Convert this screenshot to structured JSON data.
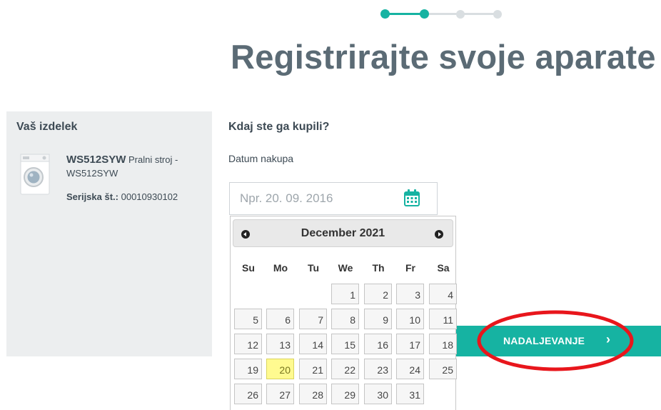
{
  "page": {
    "title": "Registrirajte svoje aparate"
  },
  "stepper": {
    "total_steps": 4,
    "current_step": 2
  },
  "product": {
    "panel_title": "Vaš izdelek",
    "model": "WS512SYW",
    "description": " Pralni stroj - WS512SYW",
    "serial_label": "Serijska št.:",
    "serial_value": " 00010930102"
  },
  "purchase": {
    "question": "Kdaj ste ga kupili?",
    "date_label": "Datum nakupa",
    "date_placeholder": "Npr. 20. 09. 2016"
  },
  "continue_label": "NADALJEVANJE",
  "continue_chevron": "›",
  "datepicker": {
    "month_title": "December 2021",
    "weekdays": [
      "Su",
      "Mo",
      "Tu",
      "We",
      "Th",
      "Fr",
      "Sa"
    ],
    "weeks": [
      [
        "",
        "",
        "",
        "1",
        "2",
        "3",
        "4"
      ],
      [
        "5",
        "6",
        "7",
        "8",
        "9",
        "10",
        "11"
      ],
      [
        "12",
        "13",
        "14",
        "15",
        "16",
        "17",
        "18"
      ],
      [
        "19",
        "20",
        "21",
        "22",
        "23",
        "24",
        "25"
      ],
      [
        "26",
        "27",
        "28",
        "29",
        "30",
        "31",
        ""
      ]
    ],
    "today": "20"
  },
  "colors": {
    "accent": "#16b3a2",
    "title": "#5b6b75",
    "annotation": "#e8161c",
    "today_highlight": "#fffa90"
  }
}
